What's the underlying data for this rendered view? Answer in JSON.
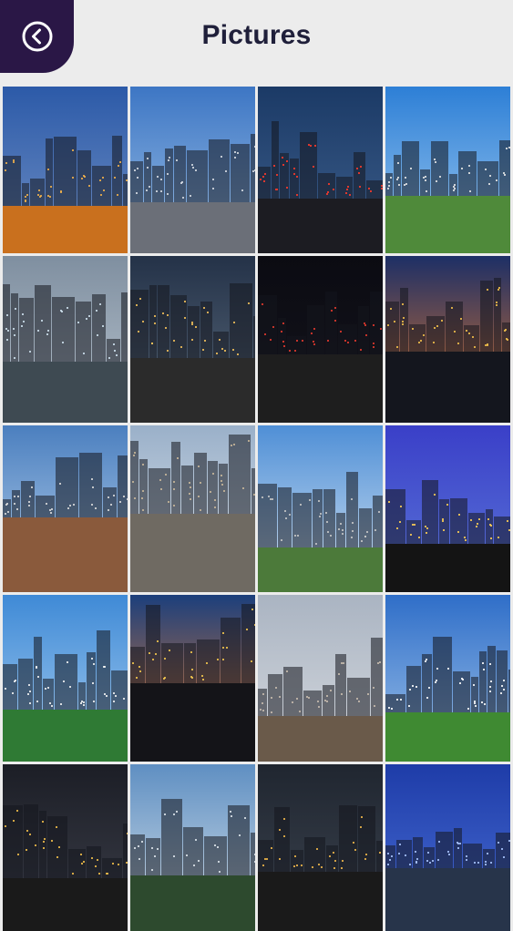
{
  "header": {
    "title": "Pictures",
    "back_icon": "chevron-left-circle-icon",
    "accent_color": "#2a1746"
  },
  "gallery": {
    "columns": 4,
    "photos": [
      {
        "name": "photo-downtown-towers-dusk",
        "sky_top": "#2c5aa8",
        "sky_bottom": "#6f8fc4",
        "ground": "#c9701e",
        "lights": "#f2b24a"
      },
      {
        "name": "photo-glass-skyscrapers-day",
        "sky_top": "#3d76c4",
        "sky_bottom": "#9cc0e6",
        "ground": "#6b6f78",
        "lights": "#d8dde4"
      },
      {
        "name": "photo-highway-light-trails",
        "sky_top": "#1b3a66",
        "sky_bottom": "#3e5f8c",
        "ground": "#1c1c22",
        "lights": "#ff3a2a"
      },
      {
        "name": "photo-city-park-skyline",
        "sky_top": "#2d7fd6",
        "sky_bottom": "#9fcaf0",
        "ground": "#4f8a3a",
        "lights": "#e7e7e7"
      },
      {
        "name": "photo-glass-office-building",
        "sky_top": "#7f8fa0",
        "sky_bottom": "#b9c4cf",
        "ground": "#3e4a52",
        "lights": "#cfe2ee"
      },
      {
        "name": "photo-street-night-lights",
        "sky_top": "#243248",
        "sky_bottom": "#5b6b7d",
        "ground": "#2b2b2b",
        "lights": "#f5c25b"
      },
      {
        "name": "photo-city-building-night",
        "sky_top": "#0b0b12",
        "sky_bottom": "#14141c",
        "ground": "#1e1e1e",
        "lights": "#e43a2e"
      },
      {
        "name": "photo-skyline-sunset",
        "sky_top": "#1d2f66",
        "sky_bottom": "#e0782c",
        "ground": "#14161e",
        "lights": "#f2c04a"
      },
      {
        "name": "photo-downtown-aerial-day",
        "sky_top": "#4b7fbf",
        "sky_bottom": "#b8d2ec",
        "ground": "#8a5a3c",
        "lights": "#dcdcdc"
      },
      {
        "name": "photo-stadium-arena",
        "sky_top": "#9ab0c9",
        "sky_bottom": "#dfe7ee",
        "ground": "#6f6a62",
        "lights": "#c9b79a"
      },
      {
        "name": "photo-skyline-lake",
        "sky_top": "#4f8fd6",
        "sky_bottom": "#d3e3f2",
        "ground": "#4c7a3a",
        "lights": "#c7c7c7"
      },
      {
        "name": "photo-skyline-night-blue",
        "sky_top": "#3a3fc8",
        "sky_bottom": "#5b76d8",
        "ground": "#141414",
        "lights": "#ffd054"
      },
      {
        "name": "photo-mountains-park-lake",
        "sky_top": "#3f8ad6",
        "sky_bottom": "#a7cdf0",
        "ground": "#2f7a34",
        "lights": "#f4f4f4"
      },
      {
        "name": "photo-skyline-orange-sunset",
        "sky_top": "#1c3f7c",
        "sky_bottom": "#f0822e",
        "ground": "#141418",
        "lights": "#f5c84e"
      },
      {
        "name": "photo-city-aerial-haze",
        "sky_top": "#aab4c2",
        "sky_bottom": "#d5d9de",
        "ground": "#6a5a4a",
        "lights": "#c8bcae"
      },
      {
        "name": "photo-white-temple",
        "sky_top": "#2f6ec8",
        "sky_bottom": "#9fc3ea",
        "ground": "#3f8a32",
        "lights": "#ffffff"
      },
      {
        "name": "photo-skyline-night-far",
        "sky_top": "#1c1e26",
        "sky_bottom": "#3c3f4a",
        "ground": "#1a1a1a",
        "lights": "#f3c04a"
      },
      {
        "name": "photo-rocky-mountain-valley",
        "sky_top": "#5f8fc2",
        "sky_bottom": "#d7e2ea",
        "ground": "#2d4a2e",
        "lights": "#dfe6ec"
      },
      {
        "name": "photo-skyline-night-lights",
        "sky_top": "#202630",
        "sky_bottom": "#3c4450",
        "ground": "#1a1a1a",
        "lights": "#f2b84a"
      },
      {
        "name": "photo-blue-glass-tower",
        "sky_top": "#1e3ca8",
        "sky_bottom": "#4a6fd6",
        "ground": "#27344a",
        "lights": "#a9c6ff"
      }
    ]
  }
}
